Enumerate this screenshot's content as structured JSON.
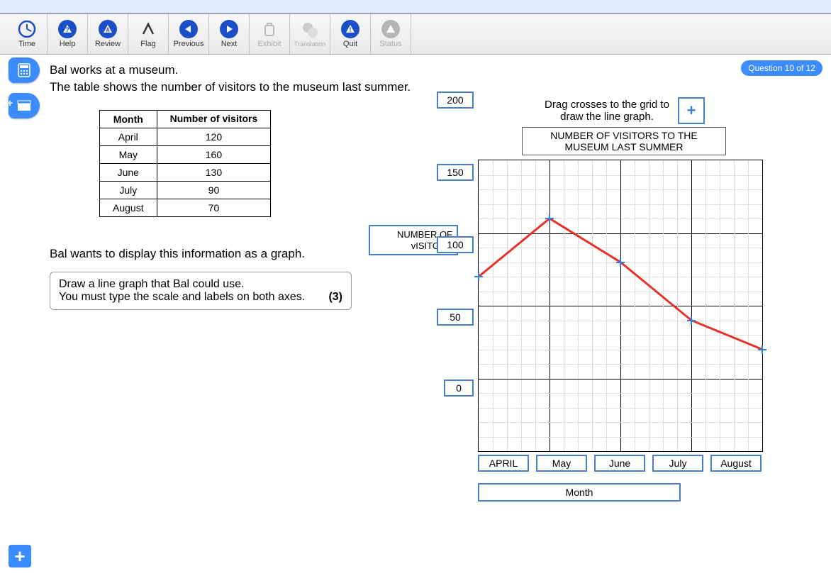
{
  "toolbar": {
    "time": "Time",
    "help": "Help",
    "review": "Review",
    "flag": "Flag",
    "previous": "Previous",
    "next": "Next",
    "exhibit": "Exhibit",
    "translation": "Translation",
    "quit": "Quit",
    "status": "Status"
  },
  "badge": "Question 10 of 12",
  "question": {
    "line1": "Bal works at a museum.",
    "line2": "The table shows the number of visitors to the museum last summer.",
    "line3": "Bal wants to display this information as a graph.",
    "box_line1": "Draw a line graph that Bal could use.",
    "box_line2": "You must type the scale and labels on both axes.",
    "marks": "(3)"
  },
  "table": {
    "head_month": "Month",
    "head_vis": "Number of visitors",
    "rows": [
      {
        "m": "April",
        "v": "120"
      },
      {
        "m": "May",
        "v": "160"
      },
      {
        "m": "June",
        "v": "130"
      },
      {
        "m": "July",
        "v": "90"
      },
      {
        "m": "August",
        "v": "70"
      }
    ]
  },
  "graph": {
    "drag_text": "Drag crosses to the grid to draw the line graph.",
    "drag_symbol": "+",
    "title": "NUMBER OF VISITORS TO THE MUSEUM LAST SUMMER",
    "ylabel": "NUMBER OF vISITORS",
    "xlabel": "Month",
    "yticks": {
      "t200": "200",
      "t150": "150",
      "t100": "100",
      "t50": "50",
      "t0": "0"
    },
    "xticks": {
      "a": "APRIL",
      "b": "May",
      "c": "June",
      "d": "July",
      "e": "August"
    }
  },
  "chart_data": {
    "type": "line",
    "title": "NUMBER OF VISITORS TO THE MUSEUM LAST SUMMER",
    "xlabel": "Month",
    "ylabel": "NUMBER OF VISITORS",
    "categories": [
      "April",
      "May",
      "June",
      "July",
      "August"
    ],
    "values": [
      120,
      160,
      130,
      90,
      70
    ],
    "ylim": [
      0,
      200
    ]
  }
}
